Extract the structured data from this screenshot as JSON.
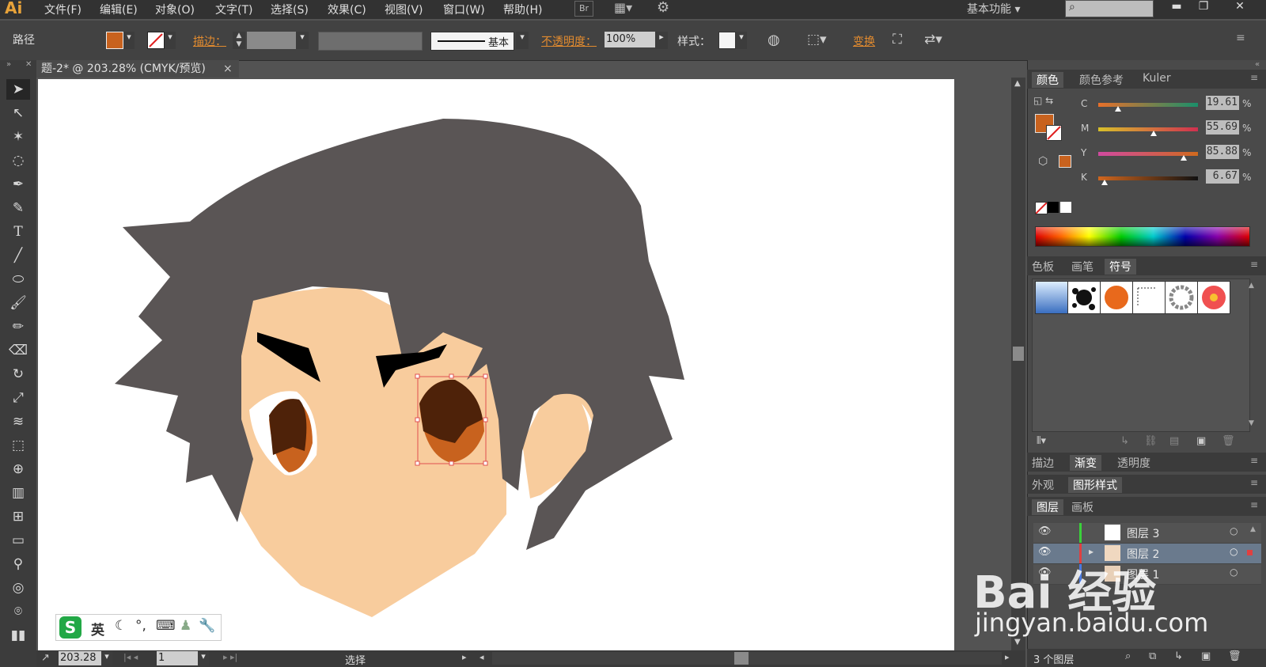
{
  "app": {
    "logo": "Ai"
  },
  "menu": [
    "文件(F)",
    "编辑(E)",
    "对象(O)",
    "文字(T)",
    "选择(S)",
    "效果(C)",
    "视图(V)",
    "窗口(W)",
    "帮助(H)"
  ],
  "menubar": {
    "bridge_label": "Br",
    "workspace": "基本功能"
  },
  "control": {
    "object_type": "路径",
    "fill_color": "#c8621e",
    "stroke_label": "描边：",
    "stroke_style_label": "基本",
    "opacity_label": "不透明度：",
    "opacity_value": "100%",
    "style_label": "样式：",
    "transform_label": "变换"
  },
  "document": {
    "tab_title": "题-2* @ 203.28% (CMYK/预览)",
    "close": "×"
  },
  "status": {
    "zoom": "203.28",
    "page": "1",
    "tool": "选择"
  },
  "color_panel": {
    "tabs": [
      "颜色",
      "颜色参考",
      "Kuler"
    ],
    "channels": [
      {
        "label": "C",
        "value": "19.61",
        "pct": 0.196
      },
      {
        "label": "M",
        "value": "55.69",
        "pct": 0.557
      },
      {
        "label": "Y",
        "value": "85.88",
        "pct": 0.859
      },
      {
        "label": "K",
        "value": "6.67",
        "pct": 0.067
      }
    ],
    "unit": "%",
    "fill_color": "#c8621e"
  },
  "swatch_panel": {
    "tabs": [
      "色板",
      "画笔",
      "符号"
    ]
  },
  "gradient_panel": {
    "tabs": [
      "描边",
      "渐变",
      "透明度"
    ]
  },
  "appearance_panel": {
    "tabs": [
      "外观",
      "图形样式"
    ]
  },
  "layers_panel": {
    "tabs": [
      "图层",
      "画板"
    ],
    "layers": [
      {
        "name": "图层 3"
      },
      {
        "name": "图层 2"
      },
      {
        "name": "图层 1"
      }
    ],
    "count": "3 个图层"
  },
  "ime": {
    "lang": "英"
  },
  "watermark": {
    "line1": "Bai 经验",
    "line2": "jingyan.baidu.com"
  }
}
